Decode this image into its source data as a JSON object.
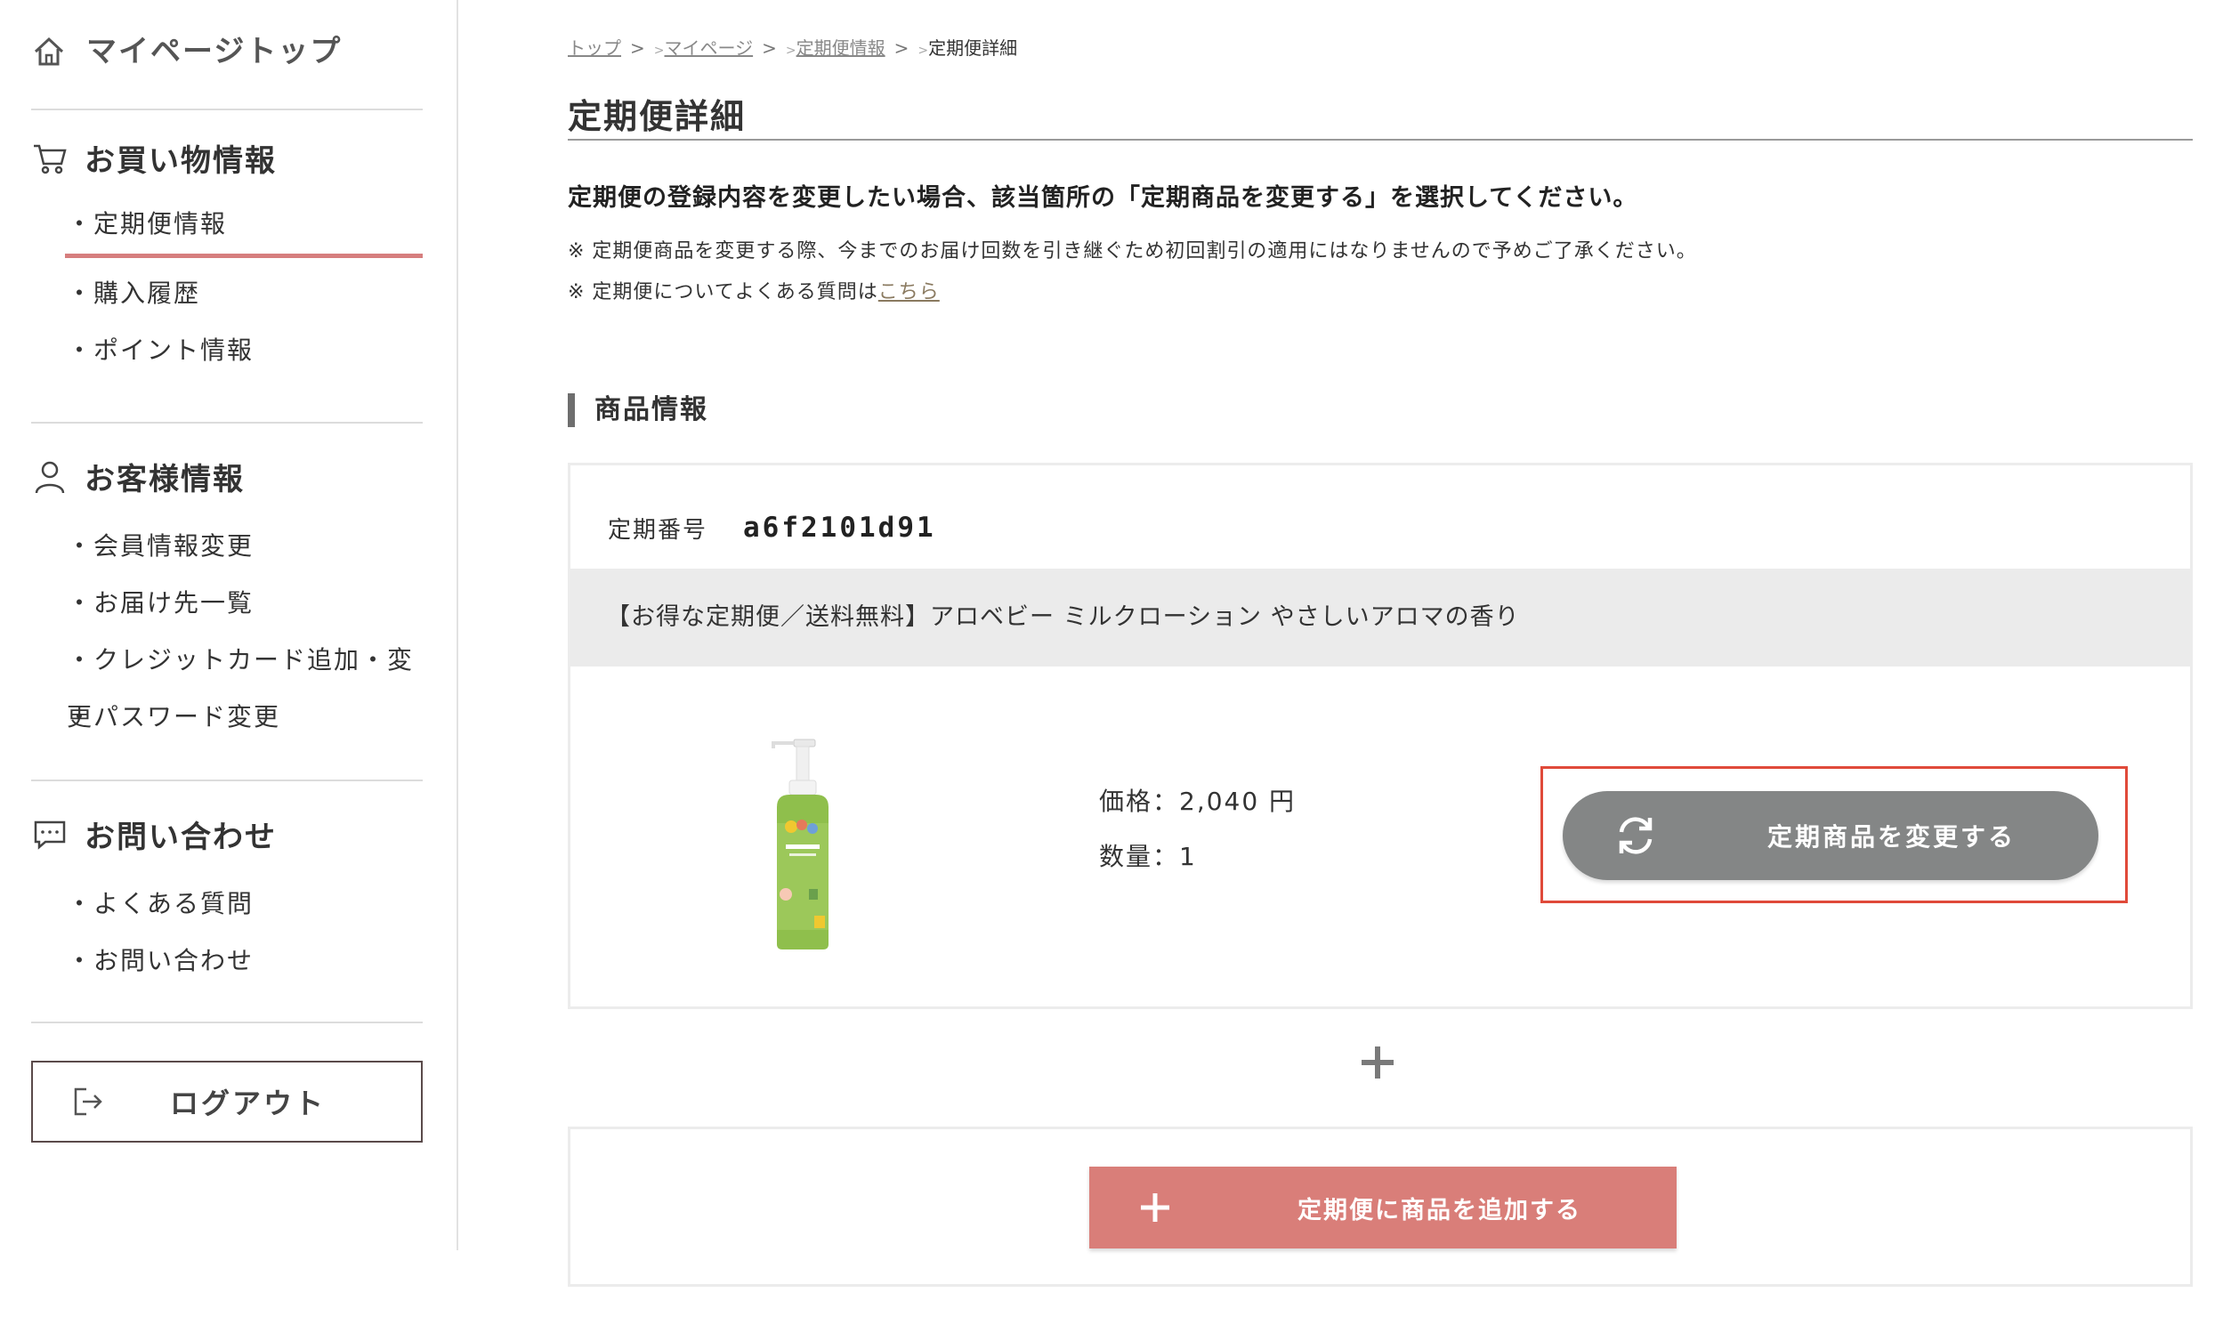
{
  "sidebar": {
    "top": {
      "label": "マイページトップ",
      "icon": "home-icon"
    },
    "sections": [
      {
        "title": "お買い物情報",
        "icon": "cart-icon",
        "items": [
          "・定期便情報",
          "・購入履歴",
          "・ポイント情報"
        ],
        "active_index": 0
      },
      {
        "title": "お客様情報",
        "icon": "person-icon",
        "items": [
          "・会員情報変更",
          "・お届け先一覧",
          "・クレジットカード追加・変更",
          "・パスワード変更"
        ]
      },
      {
        "title": "お問い合わせ",
        "icon": "chat-icon",
        "items": [
          "・よくある質問",
          "・お問い合わせ"
        ]
      }
    ],
    "logout": {
      "label": "ログアウト",
      "icon": "logout-icon"
    }
  },
  "breadcrumb": {
    "items": [
      "トップ",
      "マイページ",
      "定期便情報"
    ],
    "current": "定期便詳細",
    "sep": ">"
  },
  "page": {
    "title": "定期便詳細",
    "notice": "定期便の登録内容を変更したい場合、該当箇所の「定期商品を変更する」を選択してください。",
    "note1": "※ 定期便商品を変更する際、今までのお届け回数を引き継ぐため初回割引の適用にはなりませんので予めご了承ください。",
    "note2_prefix": "※ 定期便についてよくある質問は",
    "note2_link": "こちら",
    "section_title": "商品情報"
  },
  "subscription": {
    "number_label": "定期番号",
    "number_value": "a6f2101d91",
    "product_name": "【お得な定期便／送料無料】アロベビー ミルクローション やさしいアロマの香り",
    "price": "価格：2,040 円",
    "quantity": "数量：1",
    "change_button": "定期商品を変更する",
    "change_icon": "refresh-icon"
  },
  "add": {
    "plus_icon": "plus-icon",
    "button": "定期便に商品を追加する"
  },
  "colors": {
    "accent": "#d67e7e",
    "change_button": "#848686",
    "add_button": "#d97e79",
    "highlight": "#e04a3a"
  }
}
